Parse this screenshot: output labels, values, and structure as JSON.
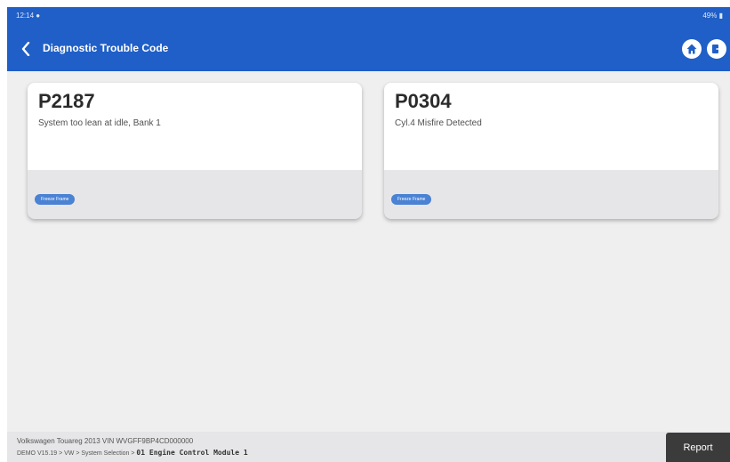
{
  "status_bar": {
    "time": "12:14 ●",
    "battery": "49% ▮"
  },
  "header": {
    "title": "Diagnostic Trouble Code",
    "back_icon": "chevron-left-icon",
    "home_icon": "home-icon",
    "exit_icon": "exit-icon",
    "accent_color": "#1f5fc7"
  },
  "dtc_cards": [
    {
      "code": "P2187",
      "description": "System too lean at idle, Bank 1",
      "chip_label": "Freeze Frame"
    },
    {
      "code": "P0304",
      "description": "Cyl.4 Misfire Detected",
      "chip_label": "Freeze Frame"
    }
  ],
  "footer": {
    "vehicle_info": "Volkswagen  Touareg  2013  VIN  WVGFF9BP4CD000000",
    "path_prefix": "DEMO V15.19 > VW > System Selection > ",
    "module_name": "01  Engine Control Module 1",
    "report_label": "Report"
  }
}
